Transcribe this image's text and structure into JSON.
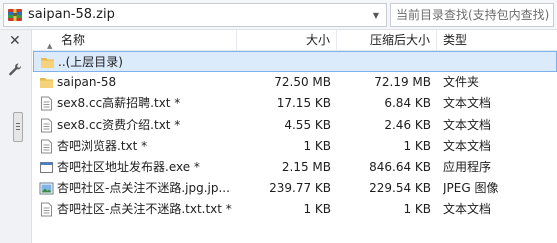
{
  "address": {
    "path": "saipan-58.zip"
  },
  "search": {
    "placeholder": "当前目录查找(支持包内查找)"
  },
  "columns": {
    "name": "名称",
    "size": "大小",
    "packed": "压缩后大小",
    "type": "类型"
  },
  "rows": [
    {
      "icon": "folder-up-icon",
      "name": "..(上层目录)",
      "size": "",
      "packed": "",
      "type": ""
    },
    {
      "icon": "folder-icon",
      "name": "saipan-58",
      "size": "72.50 MB",
      "packed": "72.19 MB",
      "type": "文件夹"
    },
    {
      "icon": "text-file-icon",
      "name": "sex8.cc高薪招聘.txt *",
      "size": "17.15 KB",
      "packed": "6.84 KB",
      "type": "文本文档"
    },
    {
      "icon": "text-file-icon",
      "name": "sex8.cc资费介绍.txt *",
      "size": "4.55 KB",
      "packed": "2.46 KB",
      "type": "文本文档"
    },
    {
      "icon": "text-file-icon",
      "name": "杏吧浏览器.txt *",
      "size": "1 KB",
      "packed": "1 KB",
      "type": "文本文档"
    },
    {
      "icon": "exe-file-icon",
      "name": "杏吧社区地址发布器.exe *",
      "size": "2.15 MB",
      "packed": "846.64 KB",
      "type": "应用程序"
    },
    {
      "icon": "image-file-icon",
      "name": "杏吧社区-点关注不迷路.jpg.jp...",
      "size": "239.77 KB",
      "packed": "229.54 KB",
      "type": "JPEG 图像"
    },
    {
      "icon": "text-file-icon",
      "name": "杏吧社区-点关注不迷路.txt.txt *",
      "size": "1 KB",
      "packed": "1 KB",
      "type": "文本文档"
    }
  ]
}
